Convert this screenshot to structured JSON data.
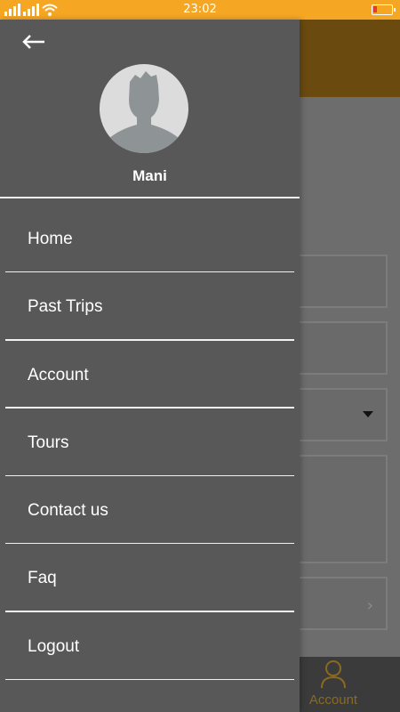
{
  "status_bar": {
    "time": "23:02",
    "battery_level_fraction": 0.2,
    "battery_color": "#e53935",
    "icons": [
      "signal-icon",
      "signal-icon",
      "wifi-icon",
      "battery-icon"
    ]
  },
  "drawer": {
    "back_icon": "arrow-left-icon",
    "user_name": "Mani",
    "menu_items": [
      {
        "label": "Home"
      },
      {
        "label": "Past Trips"
      },
      {
        "label": "Account"
      },
      {
        "label": "Tours"
      },
      {
        "label": "Contact us"
      },
      {
        "label": "Faq"
      },
      {
        "label": "Logout"
      }
    ]
  },
  "background_app": {
    "bottom_tab_label": "Account",
    "accent_color": "#f5a623"
  }
}
